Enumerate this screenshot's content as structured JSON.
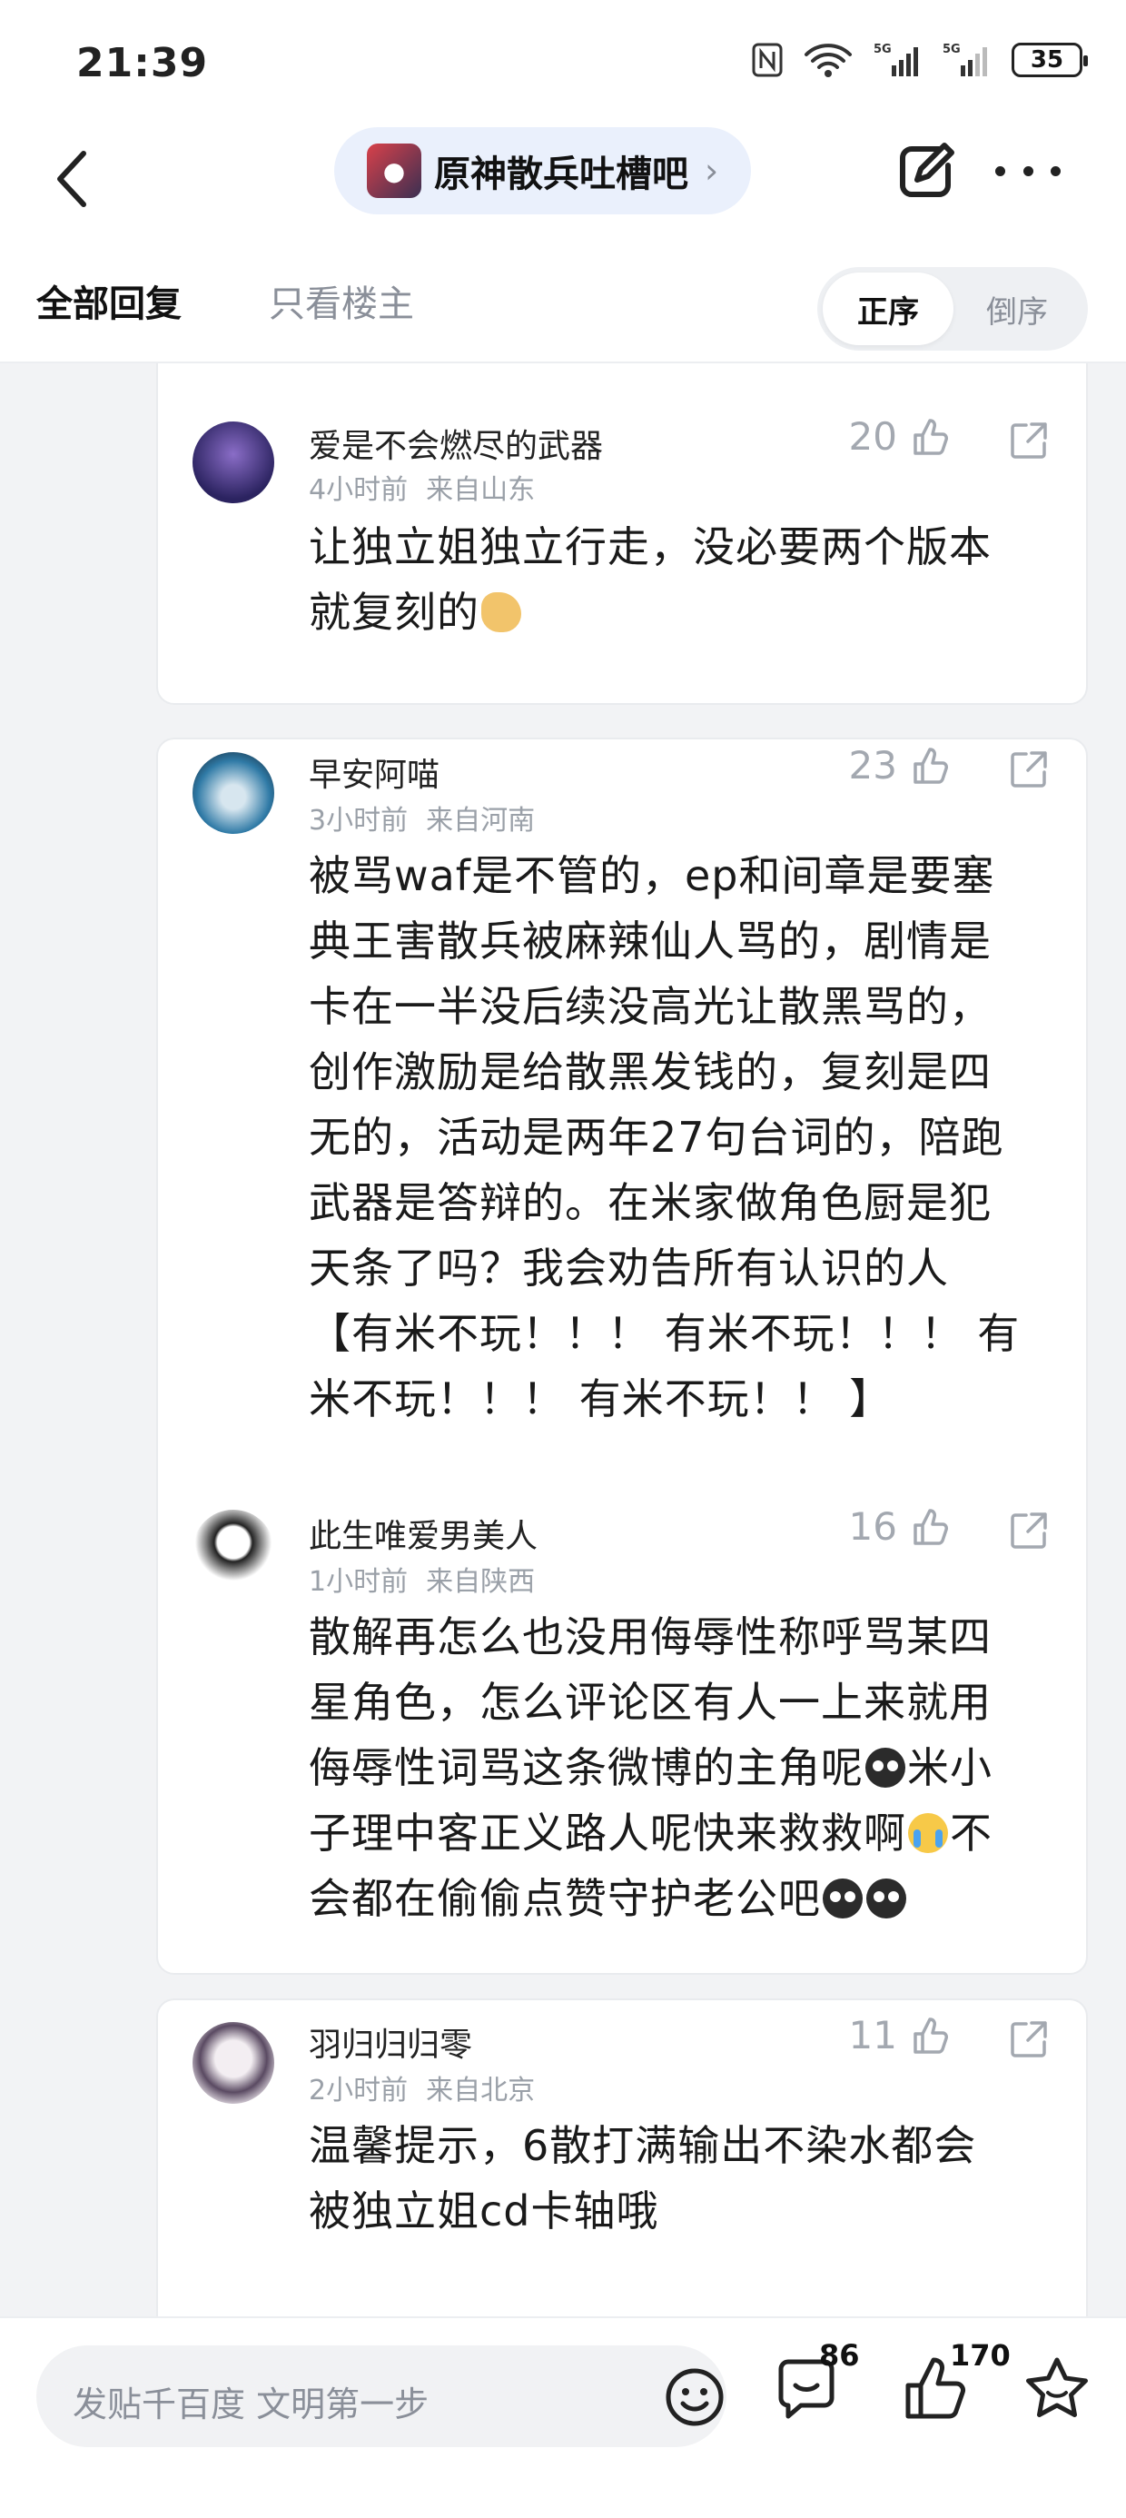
{
  "status_bar": {
    "time": "21:39",
    "battery": "35"
  },
  "nav": {
    "forum_name": "原神散兵吐槽吧"
  },
  "tabs": {
    "all_replies": "全部回复",
    "owner_only": "只看楼主",
    "order_asc": "正序",
    "order_desc": "倒序"
  },
  "comments": [
    {
      "user": "爱是不会燃尽的武器",
      "time": "4小时前",
      "location": "来自山东",
      "likes": "20",
      "lines": [
        "让独立姐独立行走，没必要两个版本",
        "就复刻的"
      ]
    },
    {
      "user": "早安阿喵",
      "time": "3小时前",
      "location": "来自河南",
      "likes": "23",
      "lines": [
        "被骂waf是不管的，ep和间章是要塞",
        "典王害散兵被麻辣仙人骂的，剧情是",
        "卡在一半没后续没高光让散黑骂的，",
        "创作激励是给散黑发钱的，复刻是四",
        "无的，活动是两年27句台词的，陪跑",
        "武器是答辩的。在米家做角色厨是犯",
        "天条了吗？我会劝告所有认识的人",
        "【有米不玩！！！ 有米不玩！！！ 有",
        "米不玩！！！ 有米不玩！！ 】"
      ]
    },
    {
      "user": "此生唯爱男美人",
      "time": "1小时前",
      "location": "来自陕西",
      "likes": "16",
      "lines": [
        "散解再怎么也没用侮辱性称呼骂某四",
        "星角色，怎么评论区有人一上来就用",
        "侮辱性词骂这条微博的主角呢",
        "米小",
        "子理中客正义路人呢快来救救啊",
        "不",
        "会都在偷偷点赞守护老公吧"
      ]
    },
    {
      "user": "羽归归归零",
      "time": "2小时前",
      "location": "来自北京",
      "likes": "11",
      "lines": [
        "温馨提示，6散打满输出不染水都会",
        "被独立姐cd卡轴哦"
      ]
    }
  ],
  "bottom_bar": {
    "placeholder": "发贴千百度 文明第一步",
    "comment_count": "86",
    "like_count": "170"
  },
  "icons": [
    "signal-icon",
    "wifi-icon",
    "nfc-icon",
    "back-icon",
    "edit-icon",
    "more-icon",
    "thumb-up-icon",
    "share-icon",
    "emoji-icon",
    "comment-icon",
    "star-icon"
  ]
}
